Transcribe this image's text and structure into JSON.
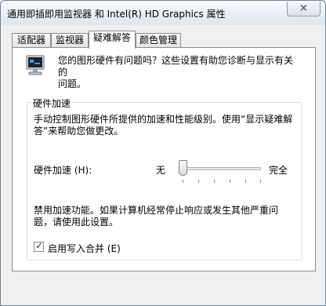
{
  "window": {
    "title": "通用即插即用监视器 和 Intel(R) HD Graphics 属性",
    "close_glyph": "×"
  },
  "tabs": [
    {
      "label": "适配器",
      "active": false
    },
    {
      "label": "监视器",
      "active": false
    },
    {
      "label": "疑难解答",
      "active": true
    },
    {
      "label": "颜色管理",
      "active": false
    }
  ],
  "panel": {
    "icon": "monitor-icon",
    "intro_line1": "您的图形硬件有问题吗？这些设置有助您诊断与显示有关的",
    "intro_line2": "问题。",
    "group": {
      "legend": "硬件加速",
      "desc_line1": "手动控制图形硬件所提供的加速和性能级别。使用“显示疑难解",
      "desc_line2": "答”来帮助您做更改。",
      "accel_label": "硬件加速 (H):",
      "slider_min_label": "无",
      "slider_max_label": "完全",
      "slider_level": 0,
      "warn_line1": "禁用加速功能。如果计算机经常停止响应或发生其他严重问",
      "warn_line2": "题，请使用此设置。",
      "checkbox_label": "启用写入合并 (E)",
      "checkbox_checked": true
    }
  }
}
